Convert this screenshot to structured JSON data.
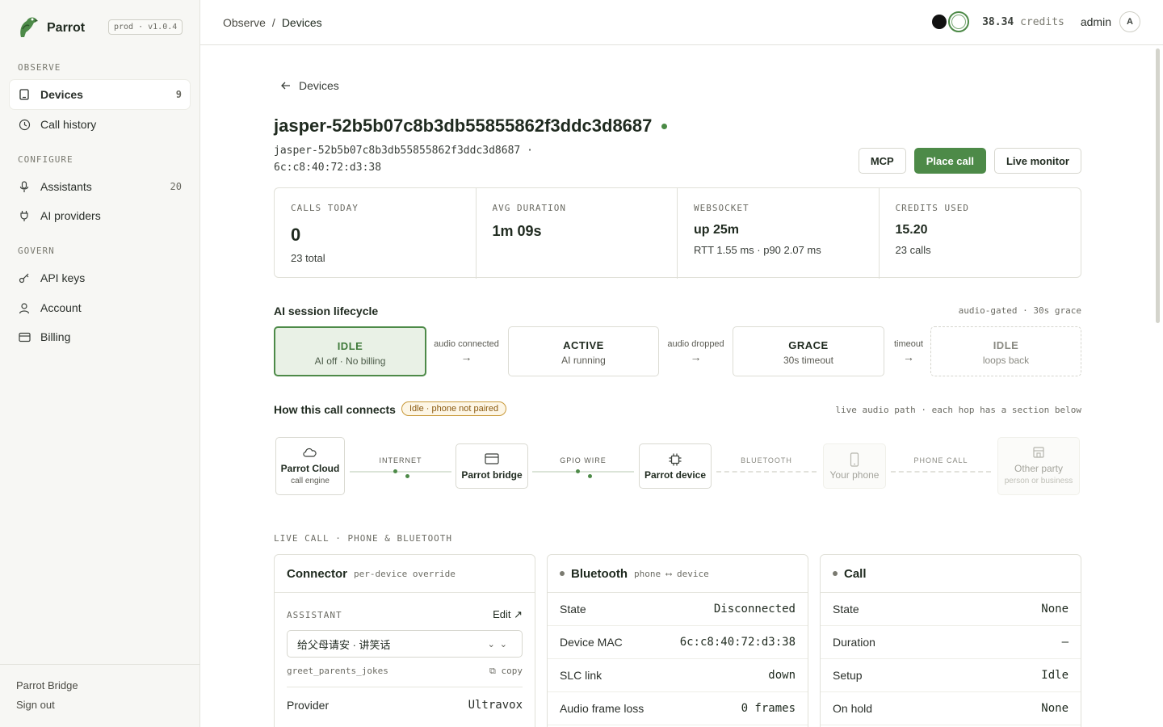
{
  "app": {
    "name": "Parrot",
    "env": "prod · v1.0.4"
  },
  "sidebar": {
    "sections": [
      {
        "title": "OBSERVE",
        "items": [
          {
            "label": "Devices",
            "count": "9"
          },
          {
            "label": "Call history",
            "count": ""
          }
        ]
      },
      {
        "title": "CONFIGURE",
        "items": [
          {
            "label": "Assistants",
            "count": "20"
          },
          {
            "label": "AI providers",
            "count": ""
          }
        ]
      },
      {
        "title": "GOVERN",
        "items": [
          {
            "label": "API keys",
            "count": ""
          },
          {
            "label": "Account",
            "count": ""
          },
          {
            "label": "Billing",
            "count": ""
          }
        ]
      }
    ],
    "footer": {
      "bridge": "Parrot Bridge",
      "signout": "Sign out"
    }
  },
  "topbar": {
    "breadcrumb": [
      "Observe",
      "/",
      "Devices"
    ],
    "credits_value": "38.34",
    "credits_label": "credits",
    "user": "admin",
    "avatar": "A"
  },
  "device": {
    "back": "Devices",
    "title": "jasper-52b5b07c8b3db55855862f3ddc3d8687",
    "sub_id": "jasper-52b5b07c8b3db55855862f3ddc3d8687 ·",
    "mac": "6c:c8:40:72:d3:38",
    "actions": {
      "mcp": "MCP",
      "place_call": "Place call",
      "live_monitor": "Live monitor"
    }
  },
  "stats": [
    {
      "label": "CALLS TODAY",
      "value": "0",
      "sub": "23 total"
    },
    {
      "label": "AVG DURATION",
      "value": "1m 09s",
      "sub": ""
    },
    {
      "label": "WEBSOCKET",
      "value": "up 25m",
      "sub": "RTT 1.55 ms · p90 2.07 ms"
    },
    {
      "label": "CREDITS USED",
      "value": "15.20",
      "sub": "23 calls"
    }
  ],
  "lifecycle": {
    "title": "AI session lifecycle",
    "note": "audio-gated · 30s grace",
    "states": [
      {
        "title": "IDLE",
        "sub": "AI off · No billing"
      },
      {
        "title": "ACTIVE",
        "sub": "AI running"
      },
      {
        "title": "GRACE",
        "sub": "30s timeout"
      },
      {
        "title": "IDLE",
        "sub": "loops back"
      }
    ],
    "transitions": [
      "audio connected",
      "audio dropped",
      "timeout"
    ]
  },
  "connects": {
    "title": "How this call connects",
    "badge": "Idle · phone not paired",
    "note": "live audio path · each hop has a section below",
    "hops": [
      {
        "name": "Parrot Cloud",
        "desc": "call engine",
        "icon": "cloud-icon"
      },
      {
        "name": "Parrot bridge",
        "desc": "",
        "icon": "bridge-icon"
      },
      {
        "name": "Parrot device",
        "desc": "",
        "icon": "chip-icon"
      },
      {
        "name": "Your phone",
        "desc": "",
        "icon": "phone-icon"
      },
      {
        "name": "Other party",
        "desc": "person or business",
        "icon": "building-icon"
      }
    ],
    "links": [
      "INTERNET",
      "GPIO WIRE",
      "BLUETOOTH",
      "PHONE CALL"
    ]
  },
  "live": {
    "heading": "LIVE CALL · PHONE & BLUETOOTH",
    "connector": {
      "title": "Connector",
      "sub": "per-device override",
      "assistant_label": "ASSISTANT",
      "edit": "Edit ↗",
      "selected": "给父母请安 · 讲笑话",
      "assistant_id": "greet_parents_jokes",
      "copy": "⧉ copy",
      "provider_label": "Provider",
      "provider_value": "Ultravox"
    },
    "bluetooth": {
      "title": "Bluetooth",
      "sub": "phone ⟷ device",
      "rows": [
        {
          "k": "State",
          "v": "Disconnected"
        },
        {
          "k": "Device MAC",
          "v": "6c:c8:40:72:d3:38"
        },
        {
          "k": "SLC link",
          "v": "down"
        },
        {
          "k": "Audio frame loss",
          "v": "0 frames"
        }
      ]
    },
    "call": {
      "title": "Call",
      "rows": [
        {
          "k": "State",
          "v": "None"
        },
        {
          "k": "Duration",
          "v": "–"
        },
        {
          "k": "Setup",
          "v": "Idle"
        },
        {
          "k": "On hold",
          "v": "None"
        }
      ]
    }
  },
  "colors": {
    "accent": "#4d8a48",
    "badge": "#c8993a"
  }
}
